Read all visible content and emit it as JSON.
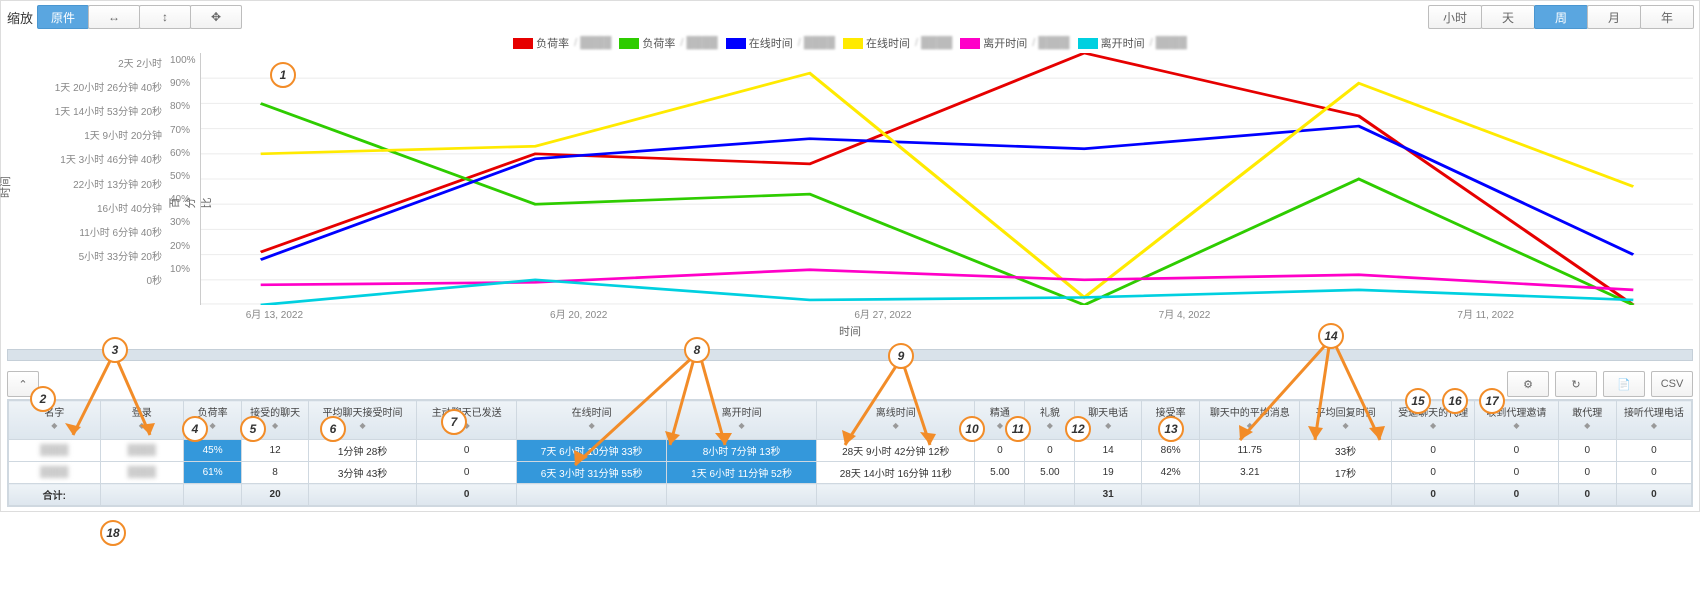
{
  "toolbar": {
    "zoom_label": "缩放",
    "zoom_buttons": [
      "原件",
      "↔",
      "↕",
      "✥"
    ],
    "zoom_active": 0,
    "range_buttons": [
      "小时",
      "天",
      "周",
      "月",
      "年"
    ],
    "range_active": 2
  },
  "legend": [
    {
      "color": "#e60000",
      "label": "负荷率",
      "sub": "/"
    },
    {
      "color": "#2ecc00",
      "label": "负荷率",
      "sub": "/"
    },
    {
      "color": "#0000ff",
      "label": "在线时间",
      "sub": "/"
    },
    {
      "color": "#ffea00",
      "label": "在线时间",
      "sub": "/"
    },
    {
      "color": "#ff00c8",
      "label": "离开时间",
      "sub": "/"
    },
    {
      "color": "#00d0e0",
      "label": "离开时间",
      "sub": "/"
    }
  ],
  "axis": {
    "left_title": "时间",
    "right_title": "百分比",
    "x_title": "时间",
    "left_ticks": [
      "2天 2小时",
      "1天 20小时 26分钟 40秒",
      "1天 14小时 53分钟 20秒",
      "1天 9小时 20分钟",
      "1天 3小时 46分钟 40秒",
      "22小时 13分钟 20秒",
      "16小时 40分钟",
      "11小时 6分钟 40秒",
      "5小时 33分钟 20秒",
      "0秒"
    ],
    "right_ticks": [
      "100%",
      "90%",
      "80%",
      "70%",
      "60%",
      "50%",
      "40%",
      "30%",
      "20%",
      "10%",
      ""
    ],
    "x_ticks": [
      "6月 13, 2022",
      "6月 20, 2022",
      "6月 27, 2022",
      "7月 4, 2022",
      "7月 11, 2022"
    ]
  },
  "chart_data": {
    "type": "line",
    "x": [
      "2022-06-13",
      "2022-06-20",
      "2022-06-27",
      "2022-07-04",
      "2022-07-11",
      "2022-07-18"
    ],
    "series": [
      {
        "name": "负荷率 A",
        "color": "#e60000",
        "axis": "right",
        "values": [
          21,
          60,
          56,
          100,
          75,
          0
        ]
      },
      {
        "name": "负荷率 B",
        "color": "#2ecc00",
        "axis": "right",
        "values": [
          80,
          40,
          44,
          0,
          50,
          0
        ]
      },
      {
        "name": "在线时间 A",
        "color": "#0000ff",
        "axis": "right",
        "values": [
          18,
          58,
          66,
          62,
          71,
          20
        ]
      },
      {
        "name": "在线时间 B",
        "color": "#ffea00",
        "axis": "right",
        "values": [
          60,
          63,
          92,
          3,
          88,
          47
        ]
      },
      {
        "name": "离开时间 A",
        "color": "#ff00c8",
        "axis": "right",
        "values": [
          8,
          9,
          14,
          10,
          12,
          6
        ]
      },
      {
        "name": "离开时间 B",
        "color": "#00d0e0",
        "axis": "right",
        "values": [
          0,
          10,
          2,
          3,
          6,
          2
        ]
      }
    ],
    "ylim_right": [
      0,
      100
    ]
  },
  "table": {
    "headers": [
      "名字",
      "登录",
      "负荷率",
      "接受的聊天",
      "平均聊天接受时间",
      "主动聊天已发送",
      "在线时间",
      "离开时间",
      "离线时间",
      "精通",
      "礼貌",
      "聊天电话",
      "接受率",
      "聊天中的平均消息",
      "平均回复时间",
      "受邀聊天的代理",
      "收到代理邀请",
      "敢代理",
      "接听代理电话"
    ],
    "rows": [
      [
        "████",
        "████",
        "45%",
        "12",
        "1分钟 28秒",
        "0",
        "7天 6小时 10分钟 33秒",
        "8小时 7分钟 13秒",
        "28天 9小时 42分钟 12秒",
        "0",
        "0",
        "14",
        "86%",
        "11.75",
        "33秒",
        "0",
        "0",
        "0",
        "0"
      ],
      [
        "████",
        "████",
        "61%",
        "8",
        "3分钟 43秒",
        "0",
        "6天 3小时 31分钟 55秒",
        "1天 6小时 11分钟 52秒",
        "28天 14小时 16分钟 11秒",
        "5.00",
        "5.00",
        "19",
        "42%",
        "3.21",
        "17秒",
        "0",
        "0",
        "0",
        "0"
      ]
    ],
    "total_label": "合计:",
    "total": [
      "合计:",
      "",
      "",
      "20",
      "",
      "0",
      "",
      "",
      "",
      "",
      "",
      "31",
      "",
      "",
      "",
      "0",
      "0",
      "0",
      "0"
    ]
  },
  "icons": {
    "collapse": "⌃",
    "gear": "⚙",
    "refresh": "↻",
    "excel": "📄",
    "csv": "CSV"
  },
  "annotations": {
    "1": "1",
    "2": "2",
    "3": "3",
    "4": "4",
    "5": "5",
    "6": "6",
    "7": "7",
    "8": "8",
    "9": "9",
    "10": "10",
    "11": "11",
    "12": "12",
    "13": "13",
    "14": "14",
    "15": "15",
    "16": "16",
    "17": "17",
    "18": "18"
  }
}
